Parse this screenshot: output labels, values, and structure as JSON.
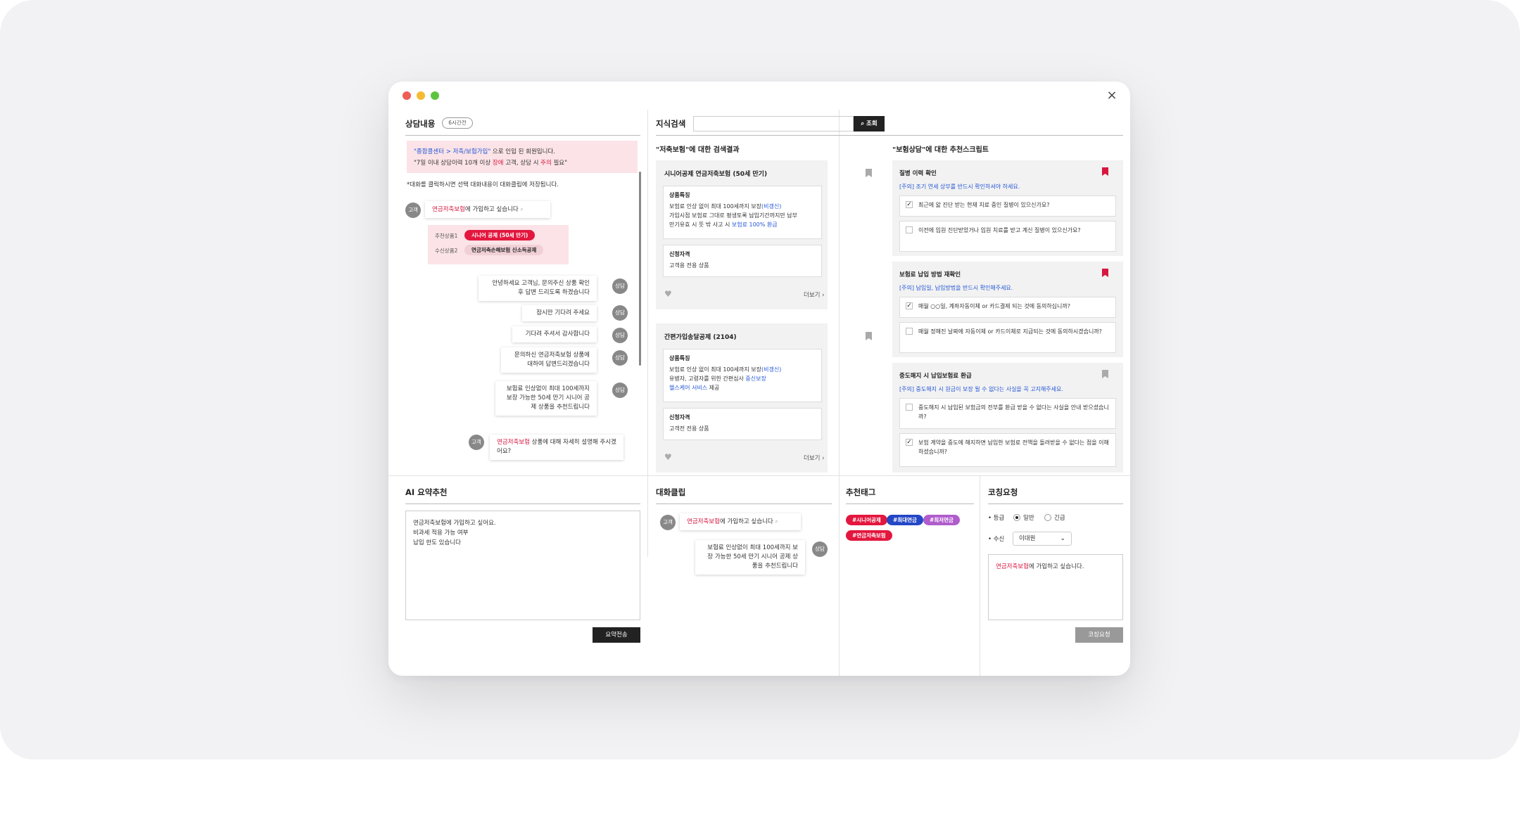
{
  "window": {
    "close": "×"
  },
  "left": {
    "title": "상담내용",
    "badge": "6시간전",
    "notice_line1_a": "\"종합콜센터 > 저축/보험가입\"",
    "notice_line1_b": " 으로 인입 된 회원입니다.",
    "notice_line2_a": "\"7일 이내 상담이력 10개 이상 ",
    "notice_line2_b": "장애",
    "notice_line2_c": " 고객, 상담 시 ",
    "notice_line2_d": "주의",
    "notice_line2_e": " 필요\"",
    "hint": "*대화를 클릭하시면 선택 대화내용이 대화클립에 저장됩니다.",
    "msg1_red": "연금저축보험",
    "msg1_rest": "에 가입하고 싶습니다",
    "reco_label1": "추천상품1",
    "reco_pill1": "시니어 공제 (50세 만기)",
    "reco_label2": "수신상품2",
    "reco_pill2": "연금저축손해보험 신소득공제",
    "msg2": "안녕하세요 고객님, 문의주신 상품 확인 후 답변 드리도록 하겠습니다",
    "msg3": "잠시만 기다려 주세요",
    "msg4": "기다려 주셔서 감사합니다",
    "msg5": "문의하신 연금저축보험 상품에 대하여 답변드리겠습니다",
    "msg6": "보험료 인상없이 최대 100세까지 보장 가능한 50세 만기 시니어 공제 상품을 추천드립니다",
    "msg7_red": "연금저축보험",
    "msg7_rest": " 상품에 대해 자세히 설명해 주시겠어요?",
    "avatar_customer": "고객",
    "avatar_agent": "상담"
  },
  "search": {
    "title": "지식검색",
    "placeholder": "",
    "button": "조회",
    "results_title": "\"저축보험\"에 대한 검색결과",
    "card1": {
      "title": "시니어공제 연금저축보험 (50세 만기)",
      "feat_h": "상품특징",
      "feat_1a": "보험료 인상 없이 최대 100세까지 보장",
      "feat_1b": "(비갱신)",
      "feat_2": "가입시점 보험료 그대로 평생토록 납입기간까지만 납부",
      "feat_3a": "만기유효 시 뜻 밖 사고 시 ",
      "feat_3b": "보험료 100% 환급",
      "qual_h": "신청자격",
      "qual": "고객용 전용 상품",
      "more": "더보기"
    },
    "card2": {
      "title": "간편가입송달공제 (2104)",
      "feat_h": "상품특징",
      "feat_1a": "보험료 인상 없이 최대 100세까지 보장",
      "feat_1b": "(비갱신)",
      "feat_2a": "유병자, 고령자를 위한 간편심사 ",
      "feat_2b": "중신보장",
      "feat_3a": "헬스케어 서비스",
      "feat_3b": " 제공",
      "qual_h": "신청자격",
      "qual": "고객전 전용 상품",
      "more": "더보기"
    }
  },
  "scripts": {
    "title": "\"보험상담\"에 대한 추천스크립트",
    "s1": {
      "title": "질병 이력 확인",
      "note": "[주의] 조기 연세 상부를 반드시 확인하셔야 하세요.",
      "q1": "최근에 앓 진단 받는 현재 치료 중인 질병이 있으신가요?",
      "q2": "이전에 입원 진단받았거나 입원 치료를 받고 계신 질병이 있으신가요?"
    },
    "s2": {
      "title": "보험료 납입 방법 재확인",
      "note": "[주의] 납입일, 납입방법을 반드시 확인해주세요.",
      "q1": "매월 ○○일, 계좌자동이체 or 카드결제 되는 것에 동의하십니까?",
      "q2": "매월 정해진 날짜에 자동이체 or 카드이체로 지급되는 것에 동의하시겠습니까?"
    },
    "s3": {
      "title": "중도해지 시 납입보험료 환급",
      "note": "[주의] 중도해지 시 원금이 보장 될 수 없다는 사실을 꼭 고지해주세요.",
      "q1": "중도해지 시 납입된 보험금의 전부를 환급 받을 수 없다는 사실을 안내 받으셨습니까?",
      "q2": "보험 계약을 중도에 해지하면 납입한 보험료 전액을 돌려받을 수 없다는 점을 이해하셨습니까?"
    }
  },
  "ai": {
    "title": "AI 요약추천",
    "line1": "연금저축보험에 가입하고 싶어요.",
    "line2": "비과세 적용 가능 여부",
    "line3": "납입 한도 있습니다",
    "button": "요약전송"
  },
  "clip": {
    "title": "대화클립",
    "msg1_red": "연금저축보험",
    "msg1_rest": "에 가입하고 싶습니다",
    "msg2": "보험료 인상없이 최대 100세까지 보장 가능한 50세 만기 시니어 공제 상품을 추천드립니다",
    "avatar_customer": "고객",
    "avatar_agent": "상담"
  },
  "tags": {
    "title": "추천태그",
    "items": [
      {
        "label": "#시니어공제",
        "color": "#e3173e"
      },
      {
        "label": "#최대연금",
        "color": "#2447c6"
      },
      {
        "label": "#최저연금",
        "color": "#b05ccc"
      },
      {
        "label": "#연금저축보험",
        "color": "#e3173e"
      }
    ]
  },
  "coach": {
    "title": "코칭요청",
    "grade_label": "• 등급",
    "opt_normal": "일반",
    "opt_urgent": "긴급",
    "recv_label": "• 수신",
    "recv_value": "이대원",
    "text_red": "연금저축보험",
    "text_rest": "에 가입하고 싶습니다.",
    "button": "코칭요청"
  }
}
